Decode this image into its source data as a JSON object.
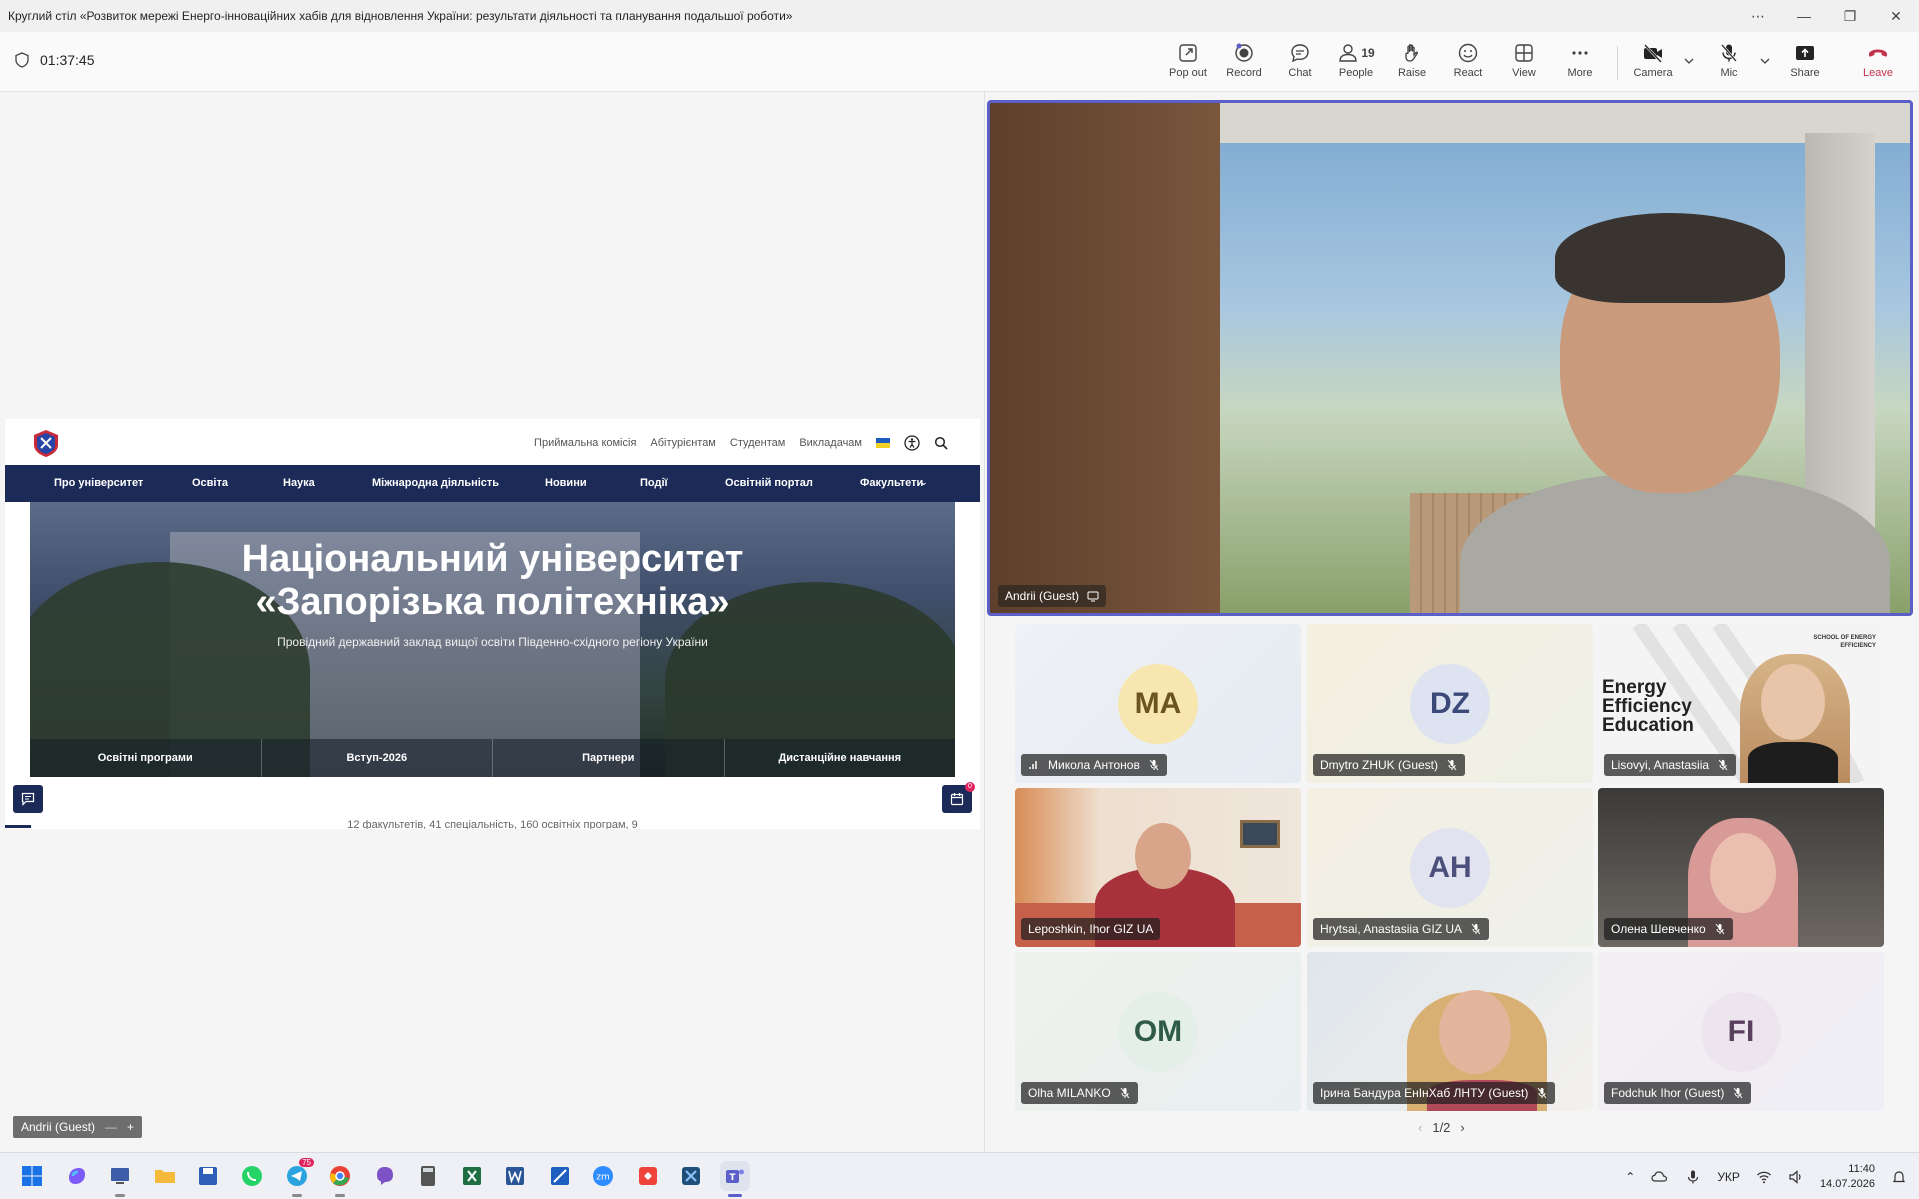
{
  "window": {
    "title": "Круглий стіл «Розвиток мережі Енерго-інноваційних хабів для відновлення України: результати діяльності та планування подальшої роботи»",
    "controls": [
      "more-icon",
      "minimize-icon",
      "restore-icon",
      "close-icon"
    ]
  },
  "meeting": {
    "timer": "01:37:45",
    "toolbar": {
      "pop_out": "Pop out",
      "record": "Record",
      "chat": "Chat",
      "people": "People",
      "people_count": "19",
      "raise": "Raise",
      "react": "React",
      "view": "View",
      "more": "More",
      "camera": "Camera",
      "mic": "Mic",
      "share": "Share",
      "leave": "Leave"
    },
    "presenter_tag": "Andrii (Guest)",
    "main_speaker": "Andrii (Guest)",
    "pager": "1/2"
  },
  "shared_site": {
    "top_links": [
      "Приймальна комісія",
      "Абітурієнтам",
      "Студентам",
      "Викладачам"
    ],
    "nav": [
      "Про університет",
      "Освіта",
      "Наука",
      "Міжнародна діяльність",
      "Новини",
      "Події",
      "Освітній портал",
      "Факультети"
    ],
    "hero_title_1": "Національний університет",
    "hero_title_2": "«Запорізька політехніка»",
    "hero_subtitle": "Провідний державний заклад вищої освіти Південно-східного регіону України",
    "quick_links": [
      "Освітні програми",
      "Вступ-2026",
      "Партнери",
      "Дистанційне навчання"
    ],
    "stats_text": "12 факультетів, 41 спеціальність, 160 освітніх програм, 9",
    "calendar_badge": "0"
  },
  "participants": [
    {
      "initials": "MA",
      "name": "Микола Антонов",
      "type": "avatar",
      "avatar_color": "#f7e6b0",
      "muted": true,
      "signal": true
    },
    {
      "initials": "DZ",
      "name": "Dmytro ZHUK (Guest)",
      "type": "avatar",
      "avatar_color": "#dde3f0",
      "muted": true
    },
    {
      "initials": "",
      "name": "Lisovyi, Anastasiia",
      "type": "video",
      "muted": true,
      "bg_text": "Energy Efficiency Education",
      "bg_logo": "SCHOOL OF ENERGY EFFICIENCY"
    },
    {
      "initials": "",
      "name": "Leposhkin, Ihor GIZ UA",
      "type": "video",
      "muted": false
    },
    {
      "initials": "AH",
      "name": "Hrytsai, Anastasiia GIZ UA",
      "type": "avatar",
      "avatar_color": "#e2e3f0",
      "muted": true
    },
    {
      "initials": "",
      "name": "Олена Шевченко",
      "type": "video",
      "muted": true
    },
    {
      "initials": "OM",
      "name": "Olha MILANKO",
      "type": "avatar",
      "avatar_color": "#e4efe9",
      "muted": true
    },
    {
      "initials": "",
      "name": "Ірина Бандура ЕнІнХаб ЛНТУ (Guest)",
      "type": "video",
      "muted": true
    },
    {
      "initials": "FI",
      "name": "Fodchuk Ihor (Guest)",
      "type": "avatar",
      "avatar_color": "#ede5ee",
      "muted": true
    }
  ],
  "taskbar": {
    "telegram_badge": "75",
    "lang": "УКР",
    "time": "11:40",
    "date": "14.07.2026"
  },
  "colors": {
    "accent": "#5b5fc7",
    "leave": "#c4314b",
    "site_nav": "#1b2a57"
  }
}
